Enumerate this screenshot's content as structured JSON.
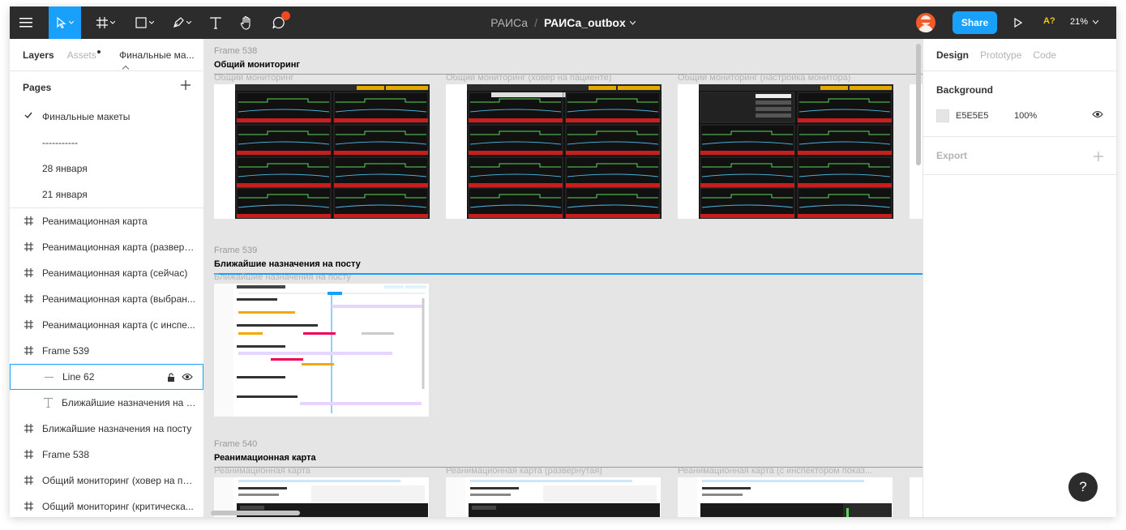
{
  "toolbar": {
    "project": "РАИСа",
    "separator": "/",
    "file_name": "РАИСа_outbox",
    "share_label": "Share",
    "collab_label": "A?",
    "zoom": "21%"
  },
  "left_panel": {
    "tabs": {
      "layers": "Layers",
      "assets": "Assets",
      "page_selector": "Финальные ма..."
    },
    "pages_title": "Pages",
    "pages": [
      "Финальные макеты",
      "-----------",
      "28 января",
      "21 января"
    ],
    "layers": [
      {
        "label": "Реанимационная карта",
        "kind": "frame"
      },
      {
        "label": "Реанимационная карта (разверн...",
        "kind": "frame"
      },
      {
        "label": "Реанимационная карта (сейчас)",
        "kind": "frame"
      },
      {
        "label": "Реанимационная карта (выбран...",
        "kind": "frame"
      },
      {
        "label": "Реанимационная карта (с инспе...",
        "kind": "frame"
      },
      {
        "label": "Frame 539",
        "kind": "frame"
      },
      {
        "label": "Line 62",
        "kind": "line"
      },
      {
        "label": "Ближайшие назначения на п...",
        "kind": "text"
      },
      {
        "label": "Ближайшие назначения на посту",
        "kind": "frame"
      },
      {
        "label": "Frame 538",
        "kind": "frame"
      },
      {
        "label": "Общий мониторинг (ховер на па...",
        "kind": "frame"
      },
      {
        "label": "Общий мониторинг (критическа...",
        "kind": "frame"
      }
    ]
  },
  "canvas": {
    "frame538": {
      "label": "Frame 538",
      "title": "Общий мониторинг",
      "items": [
        "Общий мониторинг",
        "Общий мониторинг (ховер на пациенте)",
        "Общий мониторинг (настройка монитора)"
      ]
    },
    "frame539": {
      "label": "Frame 539",
      "title": "Ближайшие назначения на посту",
      "items": [
        "Ближайшие назначения на посту"
      ]
    },
    "frame540": {
      "label": "Frame 540",
      "title": "Реанимационная карта",
      "items": [
        "Реанимационная карта",
        "Реанимационная карта (развернутая)",
        "Реанимационная карта (с инспектором показ..."
      ]
    }
  },
  "right_panel": {
    "tabs": {
      "design": "Design",
      "prototype": "Prototype",
      "code": "Code"
    },
    "background_title": "Background",
    "bg_hex": "E5E5E5",
    "bg_opacity": "100%",
    "export_title": "Export"
  },
  "help_label": "?",
  "colors": {
    "accent": "#18a0fb",
    "toolbar": "#2c2c2c",
    "canvas": "#e5e5e5"
  }
}
